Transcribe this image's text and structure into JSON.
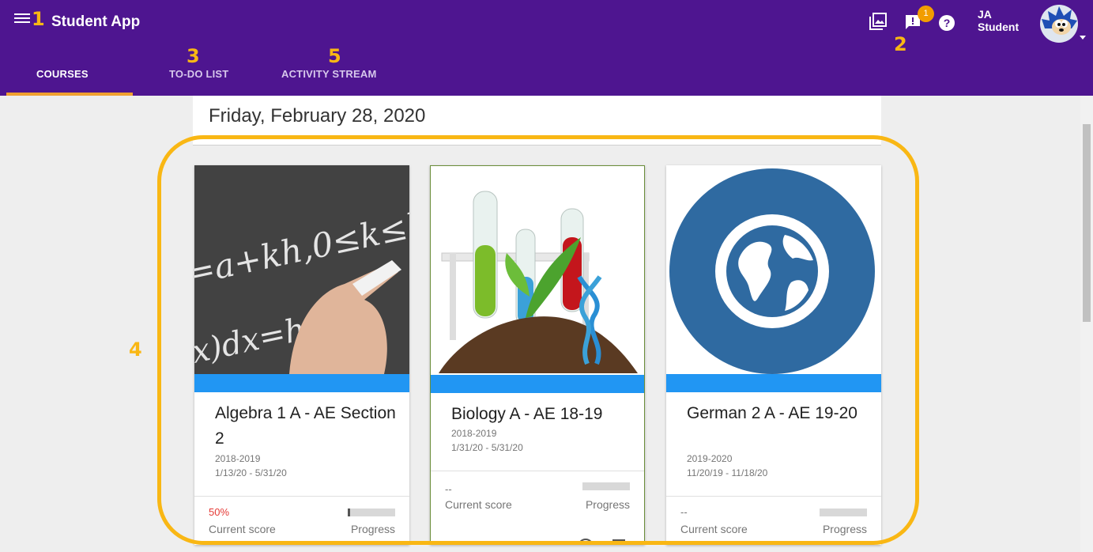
{
  "header": {
    "app_title": "Student App",
    "user_name_line1": "JA",
    "user_name_line2": "Student",
    "notification_count": "1",
    "icons": [
      "menu-icon",
      "gallery-icon",
      "feedback-icon",
      "help-icon",
      "avatar"
    ]
  },
  "tabs": [
    {
      "label": "COURSES",
      "active": true
    },
    {
      "label": "TO-DO LIST",
      "active": false
    },
    {
      "label": "ACTIVITY STREAM",
      "active": false
    }
  ],
  "annotations": {
    "n1": "1",
    "n2": "2",
    "n3": "3",
    "n4": "4",
    "n5": "5"
  },
  "main": {
    "date": "Friday, February 28, 2020"
  },
  "courses": [
    {
      "name": "Algebra 1 A - AE Section 2",
      "year": "2018-2019",
      "dates": "1/13/20 - 5/31/20",
      "score": "50%",
      "score_label": "Current score",
      "progress_label": "Progress",
      "progress": 0.05
    },
    {
      "name": "Biology A - AE 18-19",
      "year": "2018-2019",
      "dates": "1/31/20 - 5/31/20",
      "score": "--",
      "score_label": "Current score",
      "progress_label": "Progress",
      "progress": 0
    },
    {
      "name": "German 2 A - AE 19-20",
      "year": "2019-2020",
      "dates": "11/20/19 - 11/18/20",
      "score": "--",
      "score_label": "Current score",
      "progress_label": "Progress",
      "progress": 0
    }
  ],
  "colors": {
    "header": "#4e1590",
    "accent_underline": "#f0a030",
    "card_strip": "#2196f3",
    "annotation": "#f9b714",
    "score_red": "#e53935"
  }
}
